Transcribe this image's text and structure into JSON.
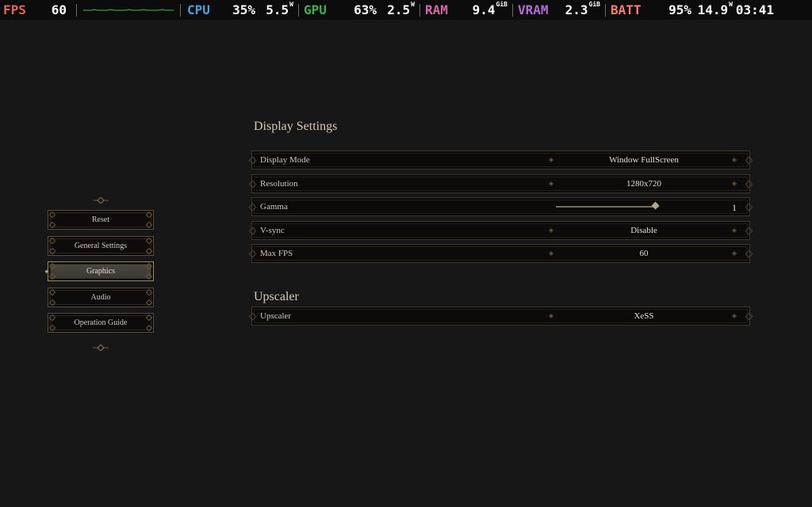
{
  "overlay": {
    "fps": {
      "label": "FPS",
      "value": "60",
      "label_color": "#e8645a"
    },
    "cpu": {
      "label": "CPU",
      "percent": "35%",
      "power": "5.5",
      "power_unit": "W",
      "label_color": "#4a9fe0"
    },
    "gpu": {
      "label": "GPU",
      "percent": "63%",
      "power": "2.5",
      "power_unit": "W",
      "label_color": "#3fae4c"
    },
    "ram": {
      "label": "RAM",
      "value": "9.4",
      "unit": "GiB",
      "label_color": "#d466a6"
    },
    "vram": {
      "label": "VRAM",
      "value": "2.3",
      "unit": "GiB",
      "label_color": "#b26cd9"
    },
    "batt": {
      "label": "BATT",
      "percent": "95%",
      "power": "14.9",
      "power_unit": "W",
      "label_color": "#ff7b68"
    },
    "clock": "03:41",
    "graph_color": "#3ec14a"
  },
  "menu": {
    "items": [
      {
        "label": "Reset",
        "active": false
      },
      {
        "label": "General Settings",
        "active": false
      },
      {
        "label": "Graphics",
        "active": true
      },
      {
        "label": "Audio",
        "active": false
      },
      {
        "label": "Operation Guide",
        "active": false
      }
    ]
  },
  "display_settings": {
    "title": "Display Settings",
    "rows": [
      {
        "label": "Display Mode",
        "value": "Window FullScreen"
      },
      {
        "label": "Resolution",
        "value": "1280x720"
      },
      {
        "label": "Gamma",
        "value": "1",
        "slider_level": 0.97
      },
      {
        "label": "V-sync",
        "value": "Disable"
      },
      {
        "label": "Max FPS",
        "value": "60"
      }
    ]
  },
  "upscaler": {
    "title": "Upscaler",
    "rows": [
      {
        "label": "Upscaler",
        "value": "XeSS"
      }
    ]
  }
}
